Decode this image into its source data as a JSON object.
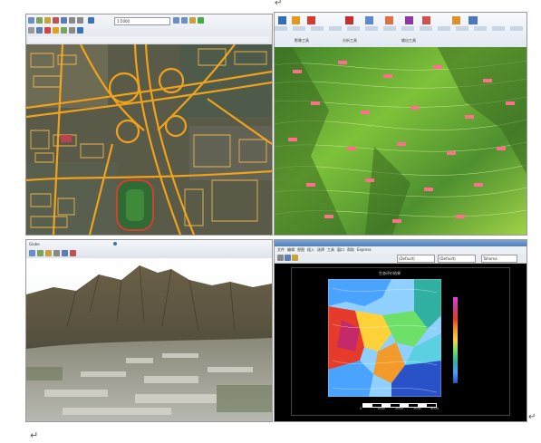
{
  "paragraph_marks": {
    "top_right": "↵",
    "bottom_left": "↵",
    "bottom_right": "↵"
  },
  "panel_tl": {
    "toolbar_zoom_text": "1:5000"
  },
  "panel_tr": {
    "ribbon_groups": [
      "影像工具",
      "分析工具",
      "输出工具"
    ]
  },
  "panel_bl": {
    "toolbar_label": "Globe"
  },
  "panel_br": {
    "menu_items": [
      "文件",
      "编辑",
      "视图",
      "插入",
      "选择",
      "工具",
      "窗口",
      "帮助",
      "Express"
    ],
    "layer_combo_1": "(Default)",
    "layer_combo_2": "(Default)",
    "font_combo": "Tahoma",
    "map_title": "生态评价结果",
    "scale_labels": [
      "0",
      "1000",
      "2000",
      "3000",
      "4000"
    ]
  }
}
